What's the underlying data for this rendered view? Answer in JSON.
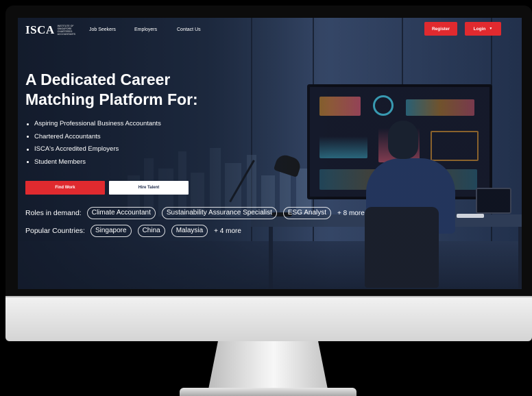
{
  "nav": {
    "logo_text": "ISCA",
    "logo_subtitle": "INSTITUTE OF SINGAPORE CHARTERED ACCOUNTANTS",
    "links": [
      "Job Seekers",
      "Employers",
      "Contact Us"
    ],
    "register_label": "Register",
    "login_label": "Login"
  },
  "hero": {
    "headline_line1": "A Dedicated Career",
    "headline_line2": "Matching Platform For:",
    "audiences": [
      "Aspiring Professional Business Accountants",
      "Chartered Accountants",
      "ISCA's Accredited Employers",
      "Student Members"
    ],
    "find_work_label": "Find Work",
    "hire_talent_label": "Hire Talent"
  },
  "roles": {
    "label": "Roles in demand:",
    "chips": [
      "Climate Accountant",
      "Sustainability Assurance Specialist",
      "ESG Analyst"
    ],
    "more": "+ 8 more"
  },
  "countries": {
    "label": "Popular Countries:",
    "chips": [
      "Singapore",
      "China",
      "Malaysia"
    ],
    "more": "+ 4 more"
  },
  "colors": {
    "accent": "#e02a2f",
    "navy": "#1d2a4a"
  },
  "icons": {
    "login_dropdown": "caret-down-icon"
  }
}
